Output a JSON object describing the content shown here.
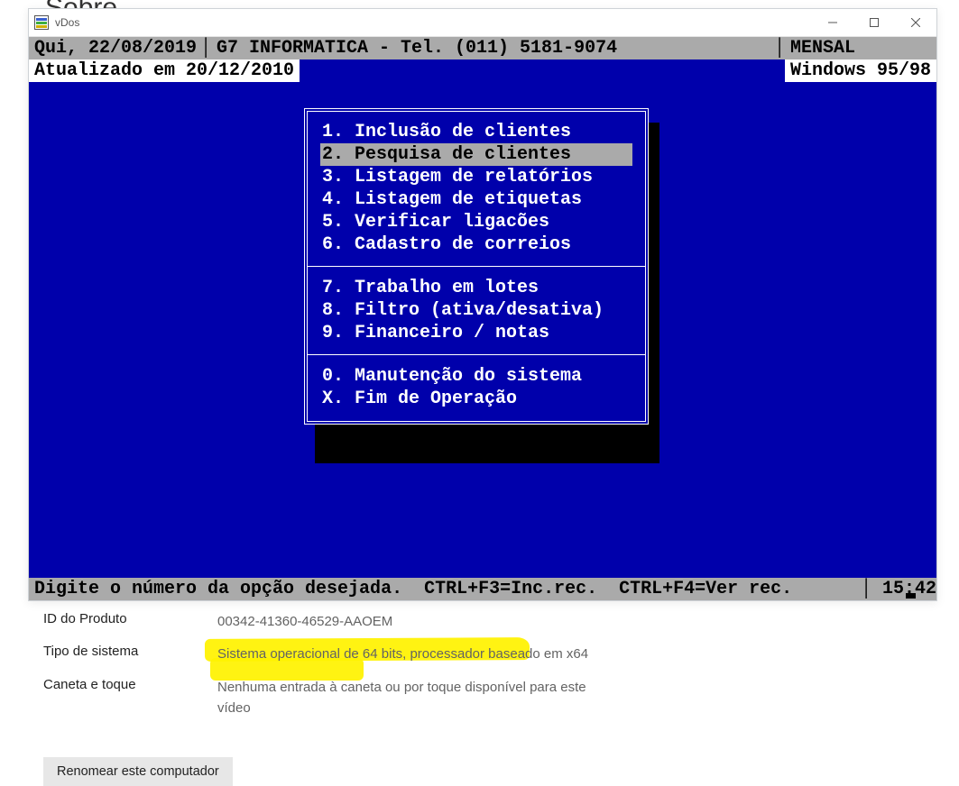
{
  "window": {
    "title": "vDos"
  },
  "dos": {
    "top": {
      "date": "Qui, 22/08/2019",
      "company": "G7 INFORMATICA - Tel. (011) 5181-9074",
      "mode": "MENSAL"
    },
    "status": {
      "left": "Atualizado em 20/12/2010",
      "right": "Windows 95/98"
    },
    "menu": {
      "items": [
        {
          "key": "1.",
          "label": "Inclusão de clientes"
        },
        {
          "key": "2.",
          "label": "Pesquisa de clientes"
        },
        {
          "key": "3.",
          "label": "Listagem de relatórios"
        },
        {
          "key": "4.",
          "label": "Listagem de etiquetas"
        },
        {
          "key": "5.",
          "label": "Verificar ligacões"
        },
        {
          "key": "6.",
          "label": "Cadastro de correios"
        }
      ],
      "items2": [
        {
          "key": "7.",
          "label": "Trabalho em lotes"
        },
        {
          "key": "8.",
          "label": "Filtro (ativa/desativa)"
        },
        {
          "key": "9.",
          "label": "Financeiro / notas"
        }
      ],
      "items3": [
        {
          "key": "0.",
          "label": "Manutenção do sistema"
        },
        {
          "key": "X.",
          "label": "Fim de Operação"
        }
      ],
      "selected_index": 1
    },
    "bottom": {
      "prompt": "Digite o número da opção desejada.  CTRL+F3=Inc.rec.  CTRL+F4=Ver rec.",
      "clock": "15:42"
    }
  },
  "settings": {
    "rows": [
      {
        "label": "ID do Produto",
        "value": "00342-41360-46529-AAOEM"
      },
      {
        "label": "Tipo de sistema",
        "value": "Sistema operacional de 64 bits, processador baseado em x64",
        "highlight": true
      },
      {
        "label": "Caneta e toque",
        "value": "Nenhuma entrada à caneta ou por toque disponível para este vídeo"
      }
    ],
    "rename_button": "Renomear este computador"
  },
  "bg_cut_text": "Sobre"
}
